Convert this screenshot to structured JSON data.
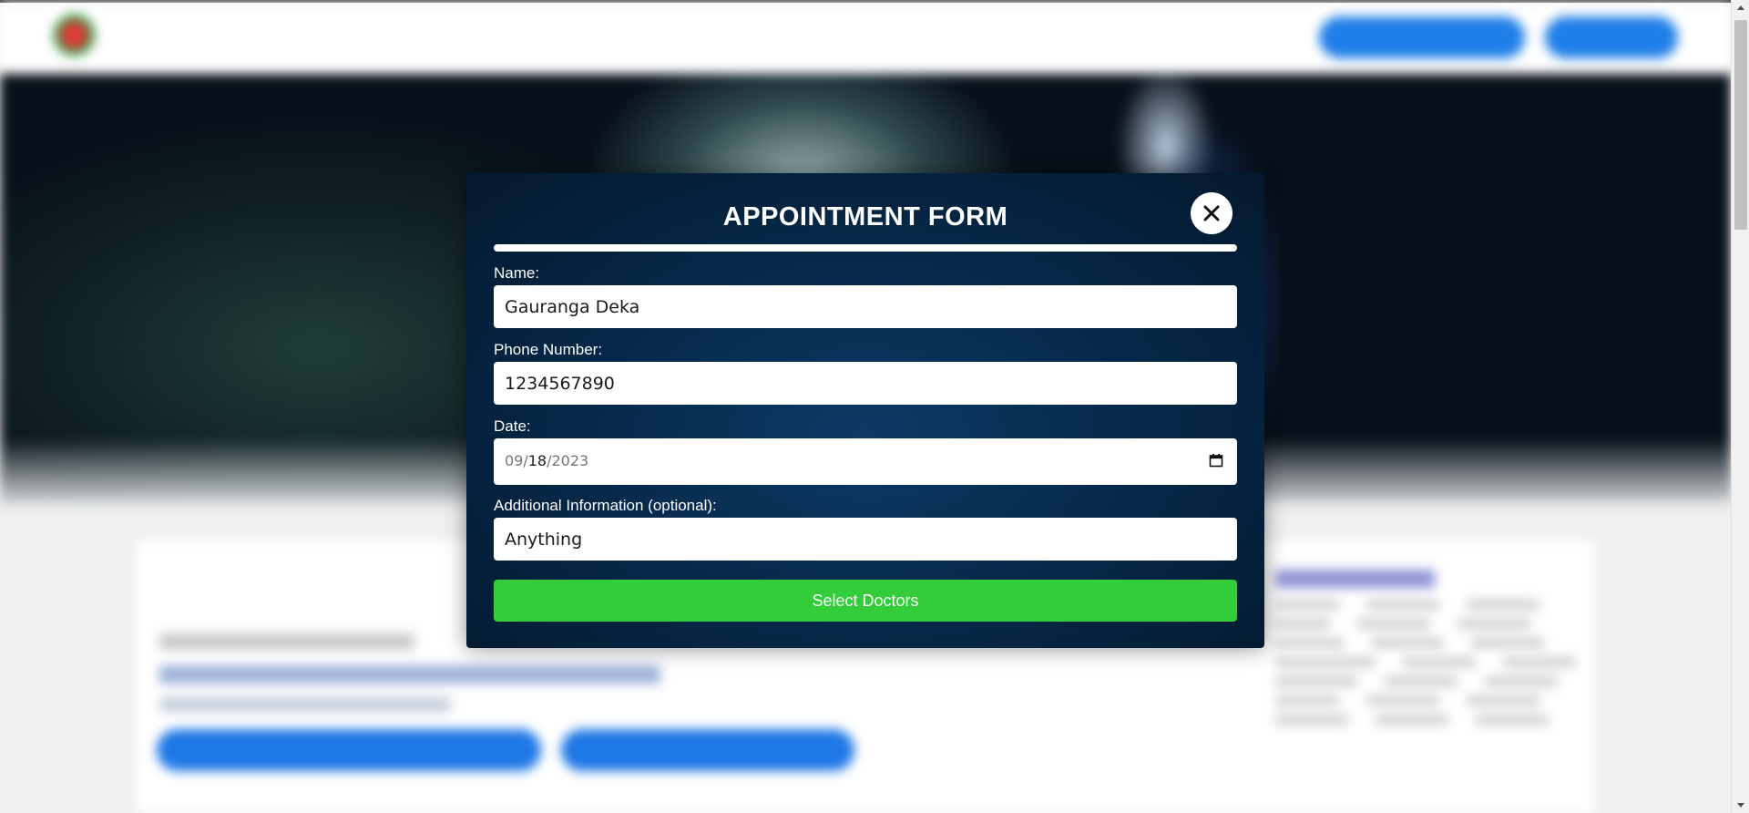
{
  "modal": {
    "title": "APPOINTMENT FORM",
    "fields": {
      "name_label": "Name:",
      "name_value": "Gauranga Deka",
      "phone_label": "Phone Number:",
      "phone_value": "1234567890",
      "date_label": "Date:",
      "date_month": "09",
      "date_day": "18",
      "date_year": "2023",
      "info_label": "Additional Information (optional):",
      "info_value": "Anything"
    },
    "submit_label": "Select Doctors",
    "close_icon": "close-icon"
  },
  "icons": {
    "close": "close-icon",
    "calendar": "calendar-icon"
  },
  "colors": {
    "submit_green": "#33cc3a",
    "modal_background": "#062a4c",
    "accent_blue": "#1f7fe8"
  }
}
